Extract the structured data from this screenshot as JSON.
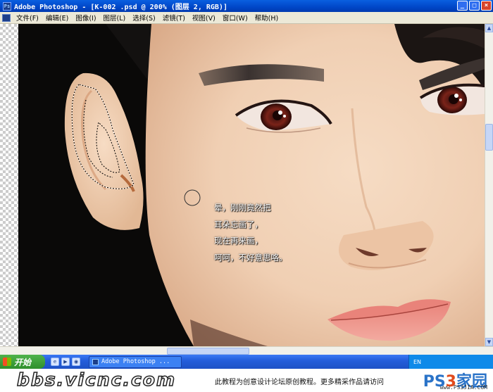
{
  "window": {
    "title": "Adobe Photoshop - [K-002 .psd @ 200% (图层 2, RGB)]",
    "minimize": "_",
    "maximize": "□",
    "close": "×"
  },
  "menu": {
    "items": [
      "文件(F)",
      "编辑(E)",
      "图像(I)",
      "图层(L)",
      "选择(S)",
      "滤镜(T)",
      "视图(V)",
      "窗口(W)",
      "帮助(H)"
    ]
  },
  "canvas": {
    "annotation": [
      "晕，刚刚竟然把",
      "耳朵忘画了，",
      "现在再来画，",
      "呵呵，不好意思咯。"
    ]
  },
  "taskbar": {
    "start_label": "开始",
    "task_label": "Adobe Photoshop ...",
    "tray_text": "EN"
  },
  "footer": {
    "logo": "bbs.vicnc.com",
    "notice": "此教程为创意设计论坛原创教程。更多精采作品请访问",
    "brand": "PS",
    "brand_num": "3",
    "brand_tail": "家园",
    "brand_url": "www.PS3JIA.COM"
  }
}
